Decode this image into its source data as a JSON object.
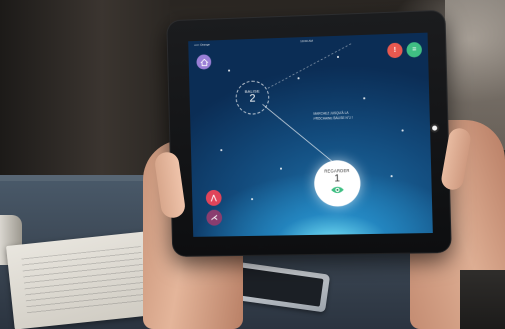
{
  "status_bar": {
    "carrier": "••••• Orange",
    "time": "10:00 AM"
  },
  "toolbar": {
    "home_icon": "home-icon",
    "alert_icon": "alert-icon",
    "list_icon": "list-icon",
    "alert_glyph": "!",
    "list_glyph": "≡"
  },
  "side_buttons": {
    "share_icon": "share-icon",
    "route_icon": "route-icon",
    "share_glyph": "⋀",
    "route_glyph": "⋌"
  },
  "beacon": {
    "label": "BALISE",
    "number": "2"
  },
  "hint": {
    "text": "MARCHEZ JUSQU'À LA PROCHAINE BALISE N°2 !"
  },
  "look_button": {
    "label": "REGARDER",
    "number": "1",
    "icon": "eye-icon"
  },
  "colors": {
    "home": "#9b7fd6",
    "alert": "#e8584f",
    "list": "#3fbf83",
    "share": "#e0445a",
    "route": "#8a3d6f",
    "eye": "#3fbf83"
  }
}
